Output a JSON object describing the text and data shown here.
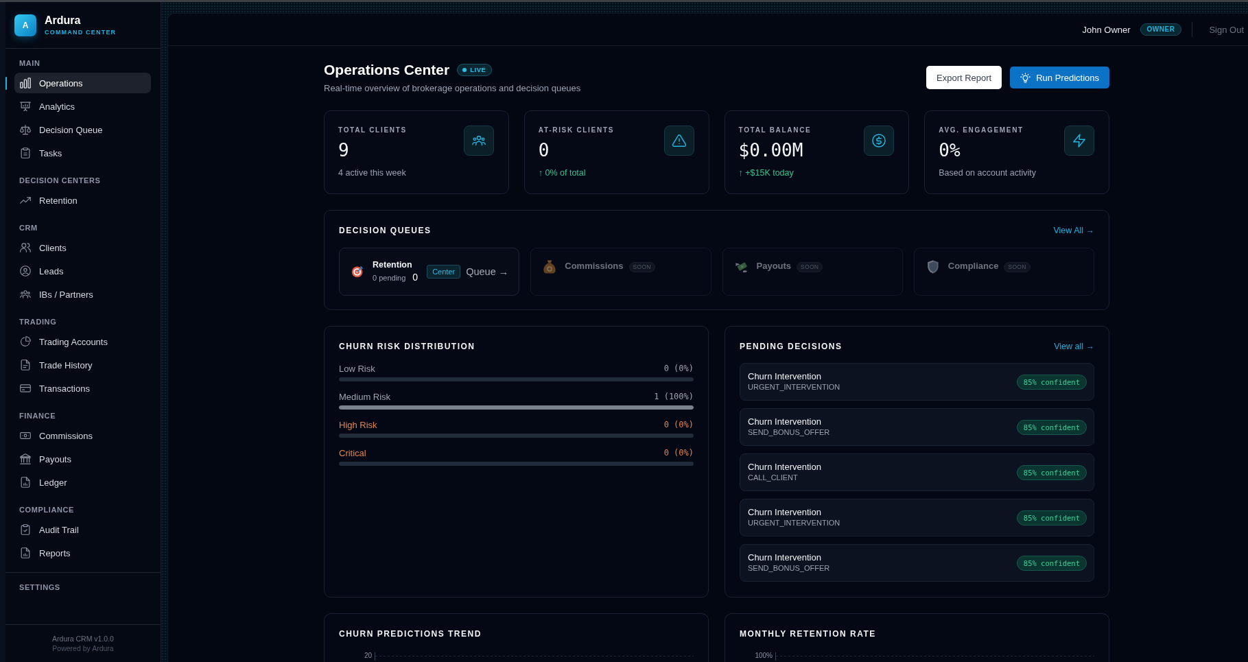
{
  "sidebar": {
    "logo": {
      "letter": "A",
      "name": "Ardura",
      "tagline": "COMMAND CENTER"
    },
    "sections": [
      {
        "title": "MAIN",
        "items": [
          {
            "label": "Operations",
            "selected": true
          },
          {
            "label": "Analytics",
            "selected": false
          },
          {
            "label": "Decision Queue",
            "selected": false
          },
          {
            "label": "Tasks",
            "selected": false
          }
        ]
      },
      {
        "title": "DECISION CENTERS",
        "items": [
          {
            "label": "Retention",
            "selected": false
          }
        ]
      },
      {
        "title": "CRM",
        "items": [
          {
            "label": "Clients",
            "selected": false
          },
          {
            "label": "Leads",
            "selected": false
          },
          {
            "label": "IBs / Partners",
            "selected": false
          }
        ]
      },
      {
        "title": "TRADING",
        "items": [
          {
            "label": "Trading Accounts",
            "selected": false
          },
          {
            "label": "Trade History",
            "selected": false
          },
          {
            "label": "Transactions",
            "selected": false
          }
        ]
      },
      {
        "title": "FINANCE",
        "items": [
          {
            "label": "Commissions",
            "selected": false
          },
          {
            "label": "Payouts",
            "selected": false
          },
          {
            "label": "Ledger",
            "selected": false
          }
        ]
      },
      {
        "title": "COMPLIANCE",
        "items": [
          {
            "label": "Audit Trail",
            "selected": false
          },
          {
            "label": "Reports",
            "selected": false
          }
        ]
      }
    ],
    "bottom_section": {
      "title": "SETTINGS"
    },
    "footer": {
      "version": "Ardura CRM v1.0.0",
      "credit": "Powered by Ardura"
    }
  },
  "header": {
    "user_name": "John Owner",
    "role": "OWNER",
    "sign_out": "Sign Out"
  },
  "page": {
    "title": "Operations Center",
    "live_badge": "LIVE",
    "subtitle": "Real-time overview of brokerage operations and decision queues",
    "buttons": [
      {
        "label": "Export Report",
        "kind": "secondary"
      },
      {
        "label": "Run Predictions",
        "kind": "primary"
      }
    ]
  },
  "stats": [
    {
      "label": "TOTAL CLIENTS",
      "value": "9",
      "note": "4 active this week",
      "positive": false
    },
    {
      "label": "AT-RISK CLIENTS",
      "value": "0",
      "note": "↑ 0% of total",
      "positive": true
    },
    {
      "label": "TOTAL BALANCE",
      "value": "$0.00M",
      "note": "↑ +$15K today",
      "positive": true
    },
    {
      "label": "AVG. ENGAGEMENT",
      "value": "0%",
      "note": "Based on account activity",
      "positive": false
    }
  ],
  "decision_queues": {
    "title": "DECISION QUEUES",
    "link": "View All →",
    "queues": [
      {
        "kind": "active",
        "name": "Retention",
        "pending": "0 pending",
        "count": "0",
        "tag": "Center",
        "link": "Queue →",
        "disabled": false
      },
      {
        "kind": "soon",
        "name": "Commissions",
        "badge": "SOON",
        "disabled": true
      },
      {
        "kind": "soon",
        "name": "Payouts",
        "badge": "SOON",
        "disabled": true
      },
      {
        "kind": "soon",
        "name": "Compliance",
        "badge": "SOON",
        "disabled": true
      }
    ]
  },
  "churn_risk": {
    "title": "CHURN RISK DISTRIBUTION",
    "rows": [
      {
        "label": "Low Risk",
        "reading": "0 (0%)",
        "level": 0,
        "color": "#9ca3af"
      },
      {
        "label": "Medium Risk",
        "reading": "1 (100%)",
        "level": 1,
        "color": "#9ca3af"
      },
      {
        "label": "High Risk",
        "reading": "0 (0%)",
        "level": 0,
        "color": "#e4834a"
      },
      {
        "label": "Critical",
        "reading": "0 (0%)",
        "level": 0,
        "color": "#e4834a"
      }
    ]
  },
  "pending_decisions": {
    "title": "PENDING DECISIONS",
    "link": "View all →",
    "items": [
      {
        "title": "Churn Intervention",
        "action": "URGENT_INTERVENTION",
        "confidence": "85% confident"
      },
      {
        "title": "Churn Intervention",
        "action": "SEND_BONUS_OFFER",
        "confidence": "85% confident"
      },
      {
        "title": "Churn Intervention",
        "action": "CALL_CLIENT",
        "confidence": "85% confident"
      },
      {
        "title": "Churn Intervention",
        "action": "URGENT_INTERVENTION",
        "confidence": "85% confident"
      },
      {
        "title": "Churn Intervention",
        "action": "SEND_BONUS_OFFER",
        "confidence": "85% confident"
      }
    ]
  },
  "charts": [
    {
      "title": "CHURN PREDICTIONS TREND",
      "top_tick": "20"
    },
    {
      "title": "MONTHLY RETENTION RATE",
      "top_tick": "100%"
    }
  ]
}
